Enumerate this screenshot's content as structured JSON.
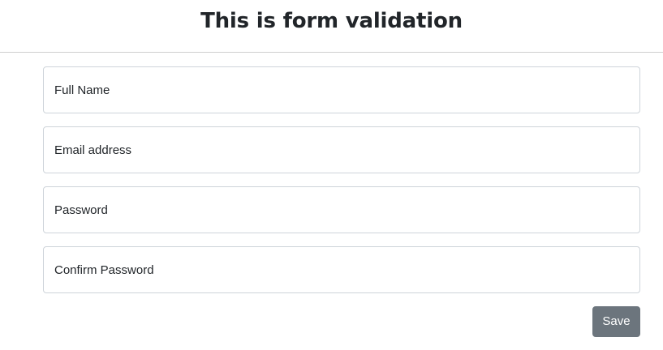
{
  "header": {
    "title": "This is form validation"
  },
  "form": {
    "fields": [
      {
        "placeholder": "Full Name",
        "value": ""
      },
      {
        "placeholder": "Email address",
        "value": ""
      },
      {
        "placeholder": "Password",
        "value": ""
      },
      {
        "placeholder": "Confirm Password",
        "value": ""
      }
    ],
    "save_label": "Save"
  },
  "colors": {
    "button_bg": "#6c757d",
    "input_border": "#ced4da",
    "text": "#212529"
  }
}
